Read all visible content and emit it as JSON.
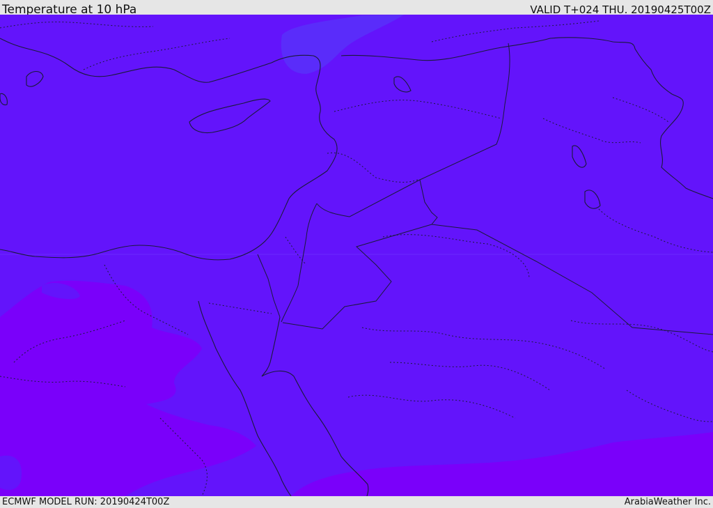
{
  "header": {
    "title": "Temperature at 10 hPa",
    "valid": "VALID T+024 THU. 20190425T00Z"
  },
  "footer": {
    "model_run": "ECMWF MODEL RUN: 20190424T00Z",
    "credit": "ArabiaWeather Inc."
  },
  "colors": {
    "field_main": "#6314fb",
    "field_cool_patch": "#5a2cfa",
    "field_warm_band": "#7a00fa",
    "coastline": "#1a1a3a",
    "bar_background": "#e6e6e6"
  }
}
